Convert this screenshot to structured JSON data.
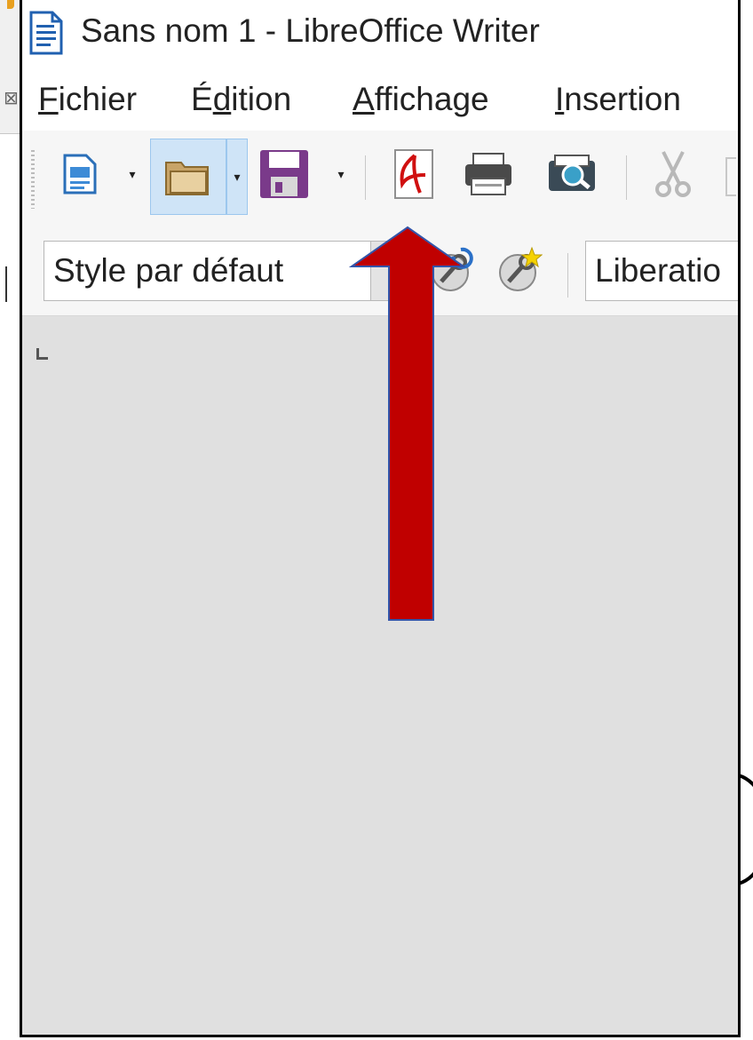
{
  "window": {
    "title": "Sans nom 1 - LibreOffice Writer"
  },
  "menu": {
    "items": [
      {
        "pre": "",
        "ul": "F",
        "post": "ichier"
      },
      {
        "pre": "É",
        "ul": "d",
        "post": "ition"
      },
      {
        "pre": "",
        "ul": "A",
        "post": "ffichage"
      },
      {
        "pre": "",
        "ul": "I",
        "post": "nsertion"
      }
    ]
  },
  "toolbar": {
    "buttons": [
      "new-document-icon",
      "open-icon",
      "save-icon",
      "export-pdf-icon",
      "print-icon",
      "print-preview-icon",
      "cut-icon"
    ],
    "dropdown_glyph": "▾"
  },
  "formatting": {
    "paragraph_style": "Style par défaut",
    "style_dropdown_glyph": "✓",
    "font_name": "Liberatio"
  },
  "annotation": {
    "arrow_color": "#c00000",
    "arrow_outline": "#3355aa",
    "target": "export-pdf-icon"
  }
}
